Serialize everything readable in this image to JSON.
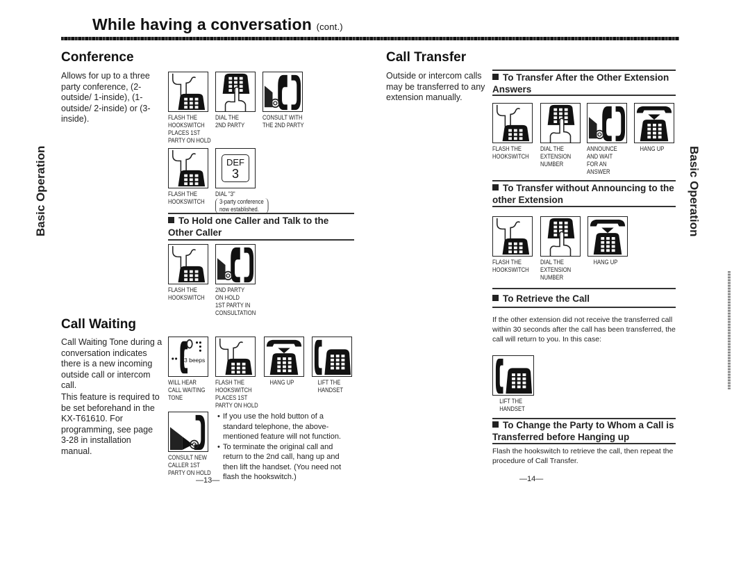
{
  "header": {
    "title": "While having a conversation",
    "title_suffix": "(cont.)"
  },
  "side_tabs": {
    "left": "Basic Operation",
    "right": "Basic Operation"
  },
  "conference": {
    "title": "Conference",
    "description": "Allows for up to a three party conference, (2-outside/ 1-inside), (1-outside/ 2-inside) or (3-inside).",
    "steps_row1": [
      {
        "icon": "flash-hookswitch-icon",
        "caption": "FLASH THE\nHOOKSWITCH\nPLACES 1ST\nPARTY ON HOLD"
      },
      {
        "icon": "dial-keypad-icon",
        "caption": "DIAL THE\n2ND PARTY"
      },
      {
        "icon": "consult-handset-icon",
        "caption": "CONSULT WITH\nTHE 2ND PARTY"
      }
    ],
    "steps_row2": [
      {
        "icon": "flash-hookswitch-icon",
        "caption": "FLASH THE\nHOOKSWITCH"
      },
      {
        "icon": "def-3-key-icon",
        "caption": "DIAL \"3\"",
        "note": "3-party conference now established.",
        "key_letters": "DEF",
        "key_digit": "3"
      }
    ]
  },
  "hold_one_caller": {
    "title": "To Hold one Caller and Talk to the Other Caller",
    "steps": [
      {
        "icon": "flash-hookswitch-icon",
        "caption": "FLASH THE\nHOOKSWITCH"
      },
      {
        "icon": "consult-handset-icon",
        "caption": "2ND PARTY\nON HOLD\n1ST PARTY IN\nCONSULTATION"
      }
    ]
  },
  "call_waiting": {
    "title": "Call Waiting",
    "description_1": "Call Waiting Tone during a conversation indicates there is a new incoming outside call or intercom call.",
    "description_2": "This feature is required to be set beforehand in the KX-T61610. For programming, see page 3-28 in installation manual.",
    "steps": [
      {
        "icon": "call-waiting-tone-icon",
        "caption": "WILL HEAR\nCALL WAITING\nTONE",
        "beeps_label": "3 beeps"
      },
      {
        "icon": "flash-hookswitch-icon",
        "caption": "FLASH THE\nHOOKSWITCH\nPLACES 1ST\nPARTY ON HOLD"
      },
      {
        "icon": "hang-up-icon",
        "caption": "HANG UP"
      },
      {
        "icon": "lift-handset-icon",
        "caption": "LIFT THE\nHANDSET"
      }
    ],
    "consult_step": {
      "icon": "consult-new-caller-icon",
      "caption": "CONSULT NEW\nCALLER 1ST\nPARTY  ON HOLD"
    },
    "notes": [
      "If you use the hold button of a standard telephone, the above-mentioned feature will not function.",
      "To terminate the original call and return to the 2nd call, hang up and then lift the handset. (You need not flash the hookswitch.)"
    ]
  },
  "left_page_number": "—13—",
  "call_transfer": {
    "title": "Call Transfer",
    "description": "Outside or intercom calls may be transferred to any extension manually.",
    "after_answer": {
      "title": "To Transfer After the Other Extension Answers",
      "steps": [
        {
          "icon": "flash-hookswitch-icon",
          "caption": "FLASH THE\nHOOKSWITCH"
        },
        {
          "icon": "dial-keypad-icon",
          "caption": "DIAL THE\nEXTENSION\nNUMBER"
        },
        {
          "icon": "consult-handset-icon",
          "caption": "ANNOUNCE\nAND WAIT\nFOR AN\nANSWER"
        },
        {
          "icon": "hang-up-icon",
          "caption": "HANG UP"
        }
      ]
    },
    "without_announcing": {
      "title": "To Transfer without Announcing to the other Extension",
      "steps": [
        {
          "icon": "flash-hookswitch-icon",
          "caption": "FLASH THE\nHOOKSWITCH"
        },
        {
          "icon": "dial-keypad-icon",
          "caption": "DIAL THE\nEXTENSION\nNUMBER"
        },
        {
          "icon": "hang-up-icon",
          "caption": "HANG UP"
        }
      ]
    },
    "retrieve": {
      "title": "To Retrieve the Call",
      "text": "If the other extension did not receive the transferred call within 30 seconds after the call has been transferred, the call will return to you. In this case:",
      "step": {
        "icon": "lift-handset-icon",
        "caption": "LIFT THE\nHANDSET"
      }
    },
    "change_party": {
      "title": "To Change the Party to Whom a Call is Transferred before Hanging up",
      "text": "Flash the hookswitch to retrieve the call, then repeat the procedure of Call Transfer."
    }
  },
  "right_page_number": "—14—"
}
